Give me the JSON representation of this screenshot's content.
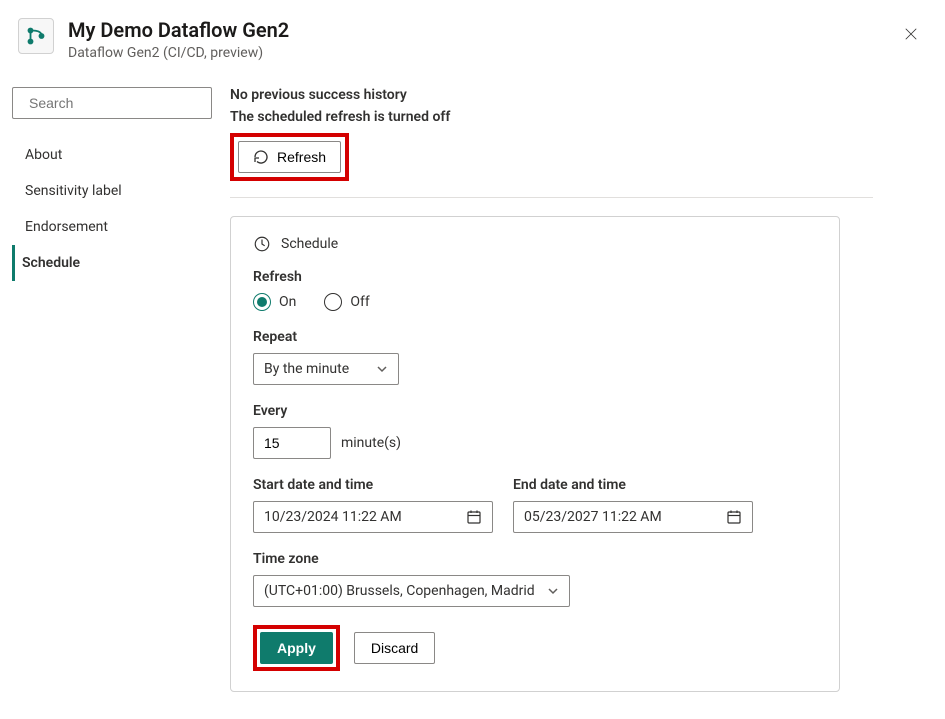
{
  "header": {
    "title": "My Demo Dataflow Gen2",
    "subtitle": "Dataflow Gen2 (CI/CD, preview)"
  },
  "sidebar": {
    "search_placeholder": "Search",
    "items": [
      {
        "label": "About"
      },
      {
        "label": "Sensitivity label"
      },
      {
        "label": "Endorsement"
      },
      {
        "label": "Schedule"
      }
    ],
    "selected_index": 3
  },
  "messages": {
    "no_history": "No previous success history",
    "sched_off": "The scheduled refresh is turned off",
    "refresh_label": "Refresh"
  },
  "schedule": {
    "section_title": "Schedule",
    "refresh_label": "Refresh",
    "on_label": "On",
    "off_label": "Off",
    "refresh_on": true,
    "repeat_label": "Repeat",
    "repeat_value": "By the minute",
    "every_label": "Every",
    "every_value": "15",
    "every_unit": "minute(s)",
    "start_label": "Start date and time",
    "start_value": "10/23/2024 11:22 AM",
    "end_label": "End date and time",
    "end_value": "05/23/2027 11:22 AM",
    "tz_label": "Time zone",
    "tz_value": "(UTC+01:00) Brussels, Copenhagen, Madrid",
    "apply_label": "Apply",
    "discard_label": "Discard"
  }
}
